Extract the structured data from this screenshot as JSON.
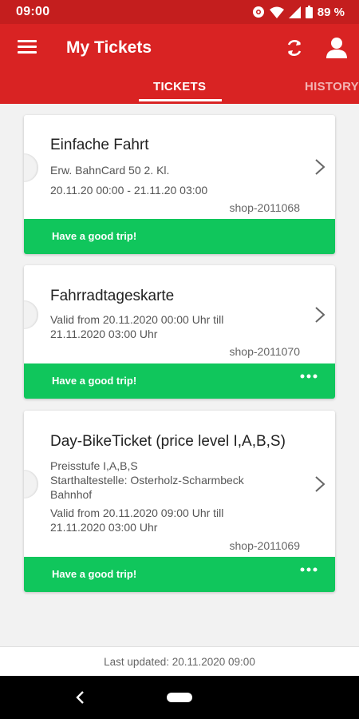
{
  "status_bar": {
    "time": "09:00",
    "battery": "89 %"
  },
  "header": {
    "title": "My Tickets"
  },
  "tabs": [
    {
      "label": "TICKETS",
      "active": true
    },
    {
      "label": "HISTORY",
      "active": false
    }
  ],
  "tickets": [
    {
      "name": "Einfache Fahrt",
      "lines": [
        "Erw. BahnCard 50 2. Kl.",
        "20.11.20 00:00  - 21.11.20 03:00"
      ],
      "code": "shop-2011068",
      "message": "Have a good trip!",
      "has_more": false
    },
    {
      "name": "Fahrradtageskarte",
      "lines": [
        "Valid from 20.11.2020 00:00 Uhr till",
        "21.11.2020 03:00 Uhr"
      ],
      "code": "shop-2011070",
      "message": "Have a good trip!",
      "has_more": true
    },
    {
      "name": "Day-BikeTicket (price level I,A,B,S)",
      "lines": [
        "Preisstufe I,A,B,S",
        "Starthaltestelle: Osterholz-Scharmbeck",
        "Bahnhof",
        "Valid from 20.11.2020 09:00 Uhr till",
        "21.11.2020 03:00 Uhr"
      ],
      "code": "shop-2011069",
      "message": "Have a good trip!",
      "has_more": true
    }
  ],
  "footer": {
    "last_updated": "Last updated: 20.11.2020 09:00"
  },
  "colors": {
    "header": "#d92323",
    "status_bar": "#c41e1e",
    "success": "#10c65c"
  }
}
